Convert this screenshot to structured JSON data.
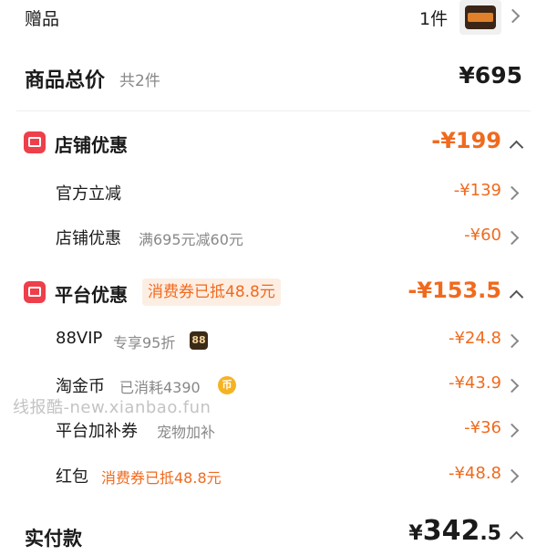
{
  "gift": {
    "label": "赠品",
    "count": "1件"
  },
  "total": {
    "label": "商品总价",
    "sub": "共2件",
    "amount": "¥695"
  },
  "store_discount": {
    "title": "店铺优惠",
    "amount": "-¥199",
    "items": [
      {
        "label": "官方立减",
        "note": "",
        "amount": "-¥139"
      },
      {
        "label": "店铺优惠",
        "note": "满695元减60元",
        "amount": "-¥60"
      }
    ]
  },
  "platform_discount": {
    "title": "平台优惠",
    "pill": "消费券已抵48.8元",
    "amount": "-¥153.5",
    "items": [
      {
        "label": "88VIP",
        "note": "专享95折",
        "badge": "88",
        "amount": "-¥24.8"
      },
      {
        "label": "淘金币",
        "note": "已消耗4390",
        "badge": "币",
        "amount": "-¥43.9"
      },
      {
        "label": "平台加补券",
        "note": "宠物加补",
        "amount": "-¥36"
      },
      {
        "label": "红包",
        "note": "消费券已抵48.8元",
        "amount": "-¥48.8"
      }
    ]
  },
  "payment": {
    "label": "实付款",
    "currency": "¥",
    "integer": "342",
    "decimal": ".5"
  },
  "watermark": "线报酷-new.xianbao.fun",
  "colors": {
    "accent": "#f06a1e",
    "icon_red": "#ee3f4a"
  }
}
